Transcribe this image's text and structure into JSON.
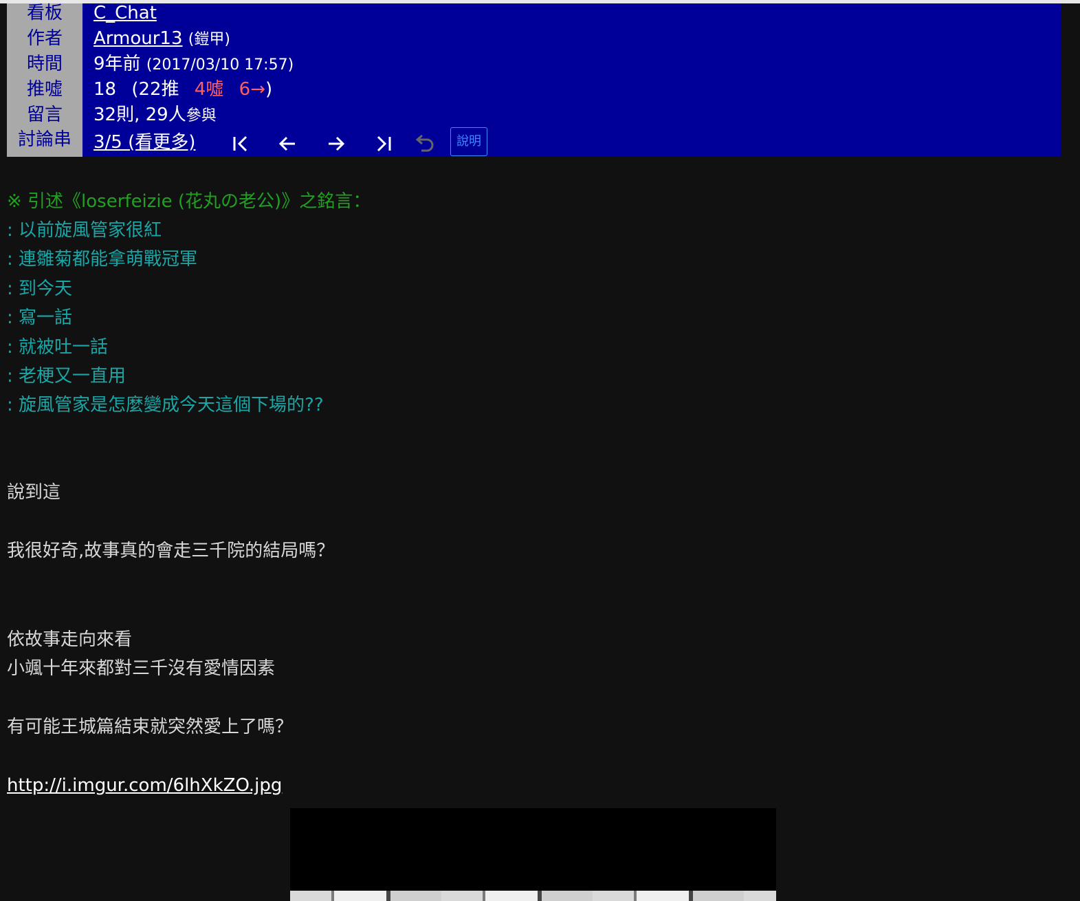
{
  "header": {
    "labels": {
      "board": "看板",
      "author": "作者",
      "time": "時間",
      "push": "推噓",
      "comments": "留言",
      "thread": "討論串"
    },
    "board": "C_Chat",
    "author_id": "Armour13",
    "author_nick": "(鎧甲)",
    "time_relative": "9年前",
    "time_exact": "(2017/03/10 17:57)",
    "push_score": "18",
    "push_open": "(22推",
    "boo": "4噓",
    "arrow": "6→",
    "push_close": ")",
    "comments_count": "32則, 29人",
    "comments_suffix": "參與",
    "thread_position": "3/5 (看更多)",
    "help_label": "說明"
  },
  "nav_icons": [
    "first-page-icon",
    "prev-arrow-icon",
    "next-arrow-icon",
    "last-page-icon",
    "undo-icon"
  ],
  "body": {
    "quote_header": "※ 引述《loserfeizie (花丸の老公)》之銘言：",
    "quotes": [
      ": 以前旋風管家很紅",
      ": 連雛菊都能拿萌戰冠軍",
      ": 到今天",
      ": 寫一話",
      ": 就被吐一話",
      ": 老梗又一直用",
      ": 旋風管家是怎麼變成今天這個下場的??"
    ],
    "paragraphs": [
      "說到這",
      "我很好奇,故事真的會走三千院的結局嗎？",
      "依故事走向來看",
      "小颯十年來都對三千沒有愛情因素",
      "有可能王城篇結束就突然愛上了嗎？"
    ],
    "image_url": "http://i.imgur.com/6lhXkZO.jpg"
  },
  "colors": {
    "header_bg": "#000099",
    "label_bg": "#a9a9a9",
    "page_bg": "#111111",
    "quote_header": "#22a022",
    "quote": "#1aa6a6",
    "boo_red": "#ff5f5f",
    "help_blue": "#3a8cff"
  }
}
